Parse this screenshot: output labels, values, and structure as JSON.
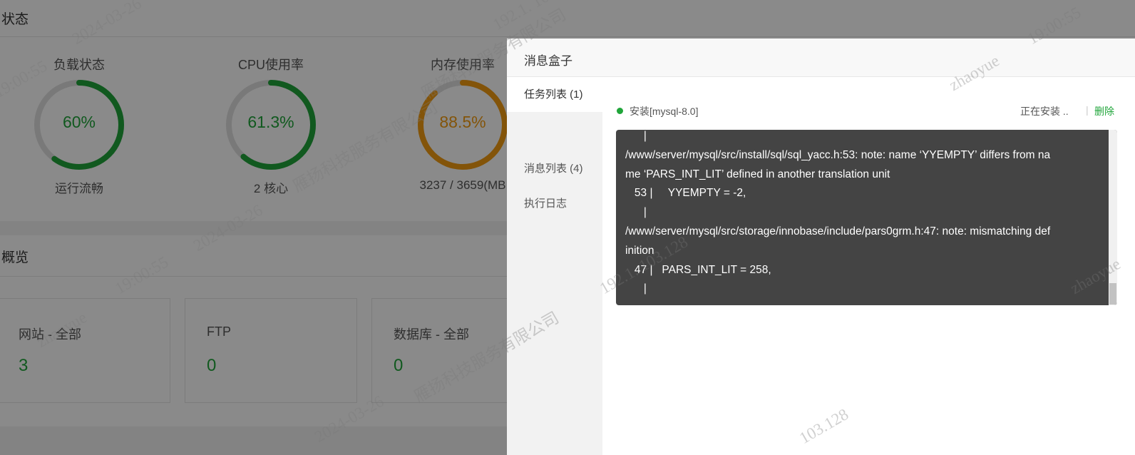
{
  "status_panel": {
    "title": "状态",
    "gauges": [
      {
        "title": "负载状态",
        "value": "60%",
        "percent": 60,
        "subtitle": "运行流畅",
        "color": "#20a53a"
      },
      {
        "title": "CPU使用率",
        "value": "61.3%",
        "percent": 61.3,
        "subtitle": "2 核心",
        "color": "#20a53a"
      },
      {
        "title": "内存使用率",
        "value": "88.5%",
        "percent": 88.5,
        "subtitle": "3237 / 3659(MB",
        "color": "#f39c12"
      }
    ]
  },
  "overview_panel": {
    "title": "概览",
    "cards": [
      {
        "label": "网站 - 全部",
        "value": "3"
      },
      {
        "label": "FTP",
        "value": "0"
      },
      {
        "label": "数据库 - 全部",
        "value": "0"
      }
    ]
  },
  "dialog": {
    "title": "消息盒子",
    "tabs": [
      {
        "label": "任务列表 (1)",
        "active": true
      },
      {
        "label": "消息列表 (4)",
        "active": false
      },
      {
        "label": "执行日志",
        "active": false
      }
    ],
    "task": {
      "name": "安装[mysql-8.0]",
      "status": "正在安装 ..",
      "separator": "|",
      "delete_label": "删除",
      "status_color": "#20a53a"
    },
    "log_lines": [
      "      |",
      "/www/server/mysql/src/install/sql/sql_yacc.h:53: note: name ‘YYEMPTY’ differs from na",
      "me ‘PARS_INT_LIT’ defined in another translation unit",
      "   53 |     YYEMPTY = -2,",
      "      |",
      "/www/server/mysql/src/storage/innobase/include/pars0grm.h:47: note: mismatching def",
      "inition",
      "   47 |   PARS_INT_LIT = 258,",
      "      |"
    ]
  },
  "watermark": {
    "name_cn": "雁扬科技服务有限公司",
    "user": "zhaoyue",
    "date": "2024-03-26",
    "time": "19:00:55",
    "ip_fragment": "103.128",
    "ip_prefix": "192.1"
  }
}
